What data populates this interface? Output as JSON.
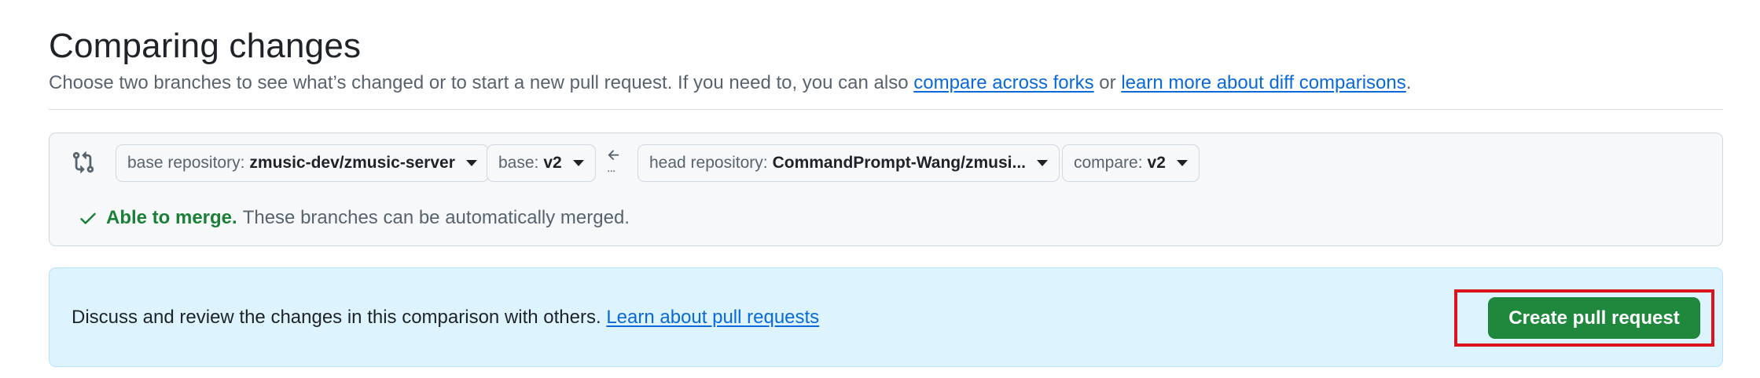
{
  "header": {
    "title": "Comparing changes",
    "subtitle_text": "Choose two branches to see what’s changed or to start a new pull request. If you need to, you can also ",
    "compare_forks_link": "compare across forks",
    "subtitle_or": " or ",
    "diff_link": "learn more about diff comparisons",
    "subtitle_end": "."
  },
  "range_editor": {
    "compare_icon": "git-compare-icon",
    "base_repo": {
      "label": "base repository:",
      "value": "zmusic-dev/zmusic-server"
    },
    "base": {
      "label": "base:",
      "value": "v2"
    },
    "arrow_icon": "arrow-left-icon",
    "arrow_dots": "...",
    "head_repo": {
      "label": "head repository:",
      "value": "CommandPrompt-Wang/zmusi..."
    },
    "compare": {
      "label": "compare:",
      "value": "v2"
    },
    "merge_status": {
      "icon": "check-icon",
      "title": "Able to merge.",
      "description": "These branches can be automatically merged."
    }
  },
  "blankslate": {
    "message": "Discuss and review the changes in this comparison with others. ",
    "link": "Learn about pull requests",
    "button_label": "Create pull request"
  },
  "colors": {
    "primary_button": "#1f883d",
    "link": "#0969da",
    "success": "#1a7f37",
    "info_bg": "#ddf4ff",
    "highlight_box": "#d9141f"
  }
}
